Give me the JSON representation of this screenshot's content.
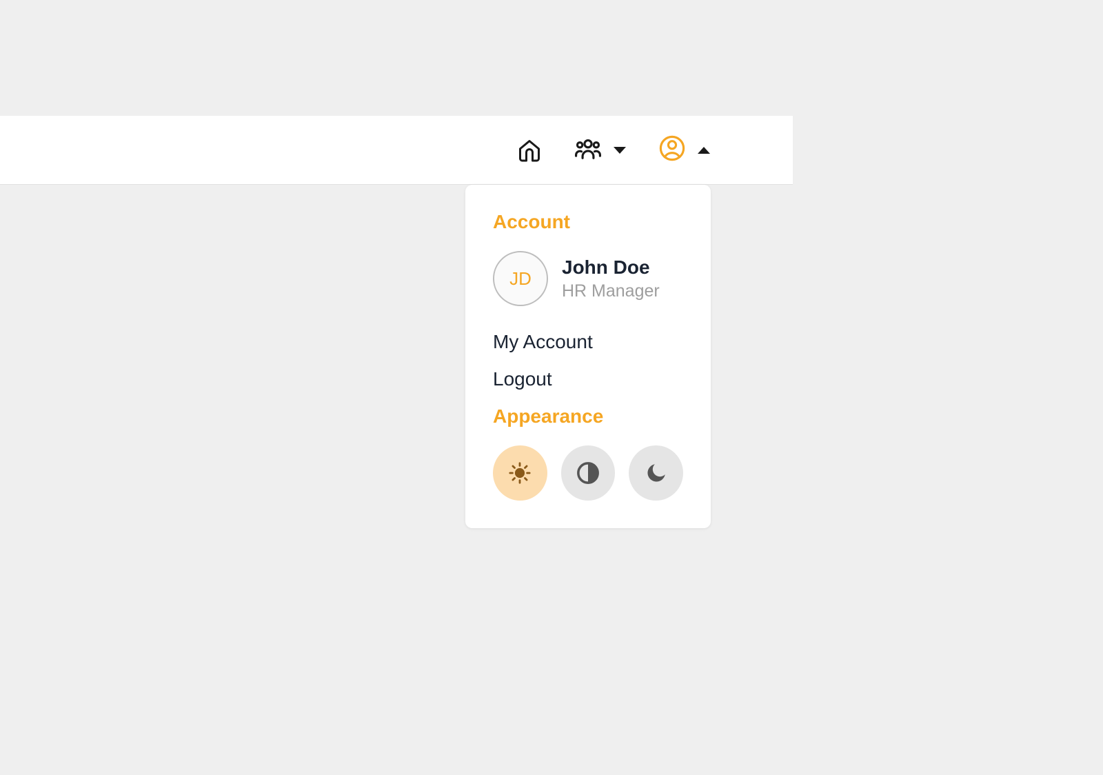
{
  "dropdown": {
    "account_header": "Account",
    "user": {
      "initials": "JD",
      "name": "John Doe",
      "role": "HR Manager"
    },
    "menu": {
      "my_account": "My Account",
      "logout": "Logout"
    },
    "appearance_header": "Appearance"
  },
  "colors": {
    "accent": "#f5a623"
  }
}
